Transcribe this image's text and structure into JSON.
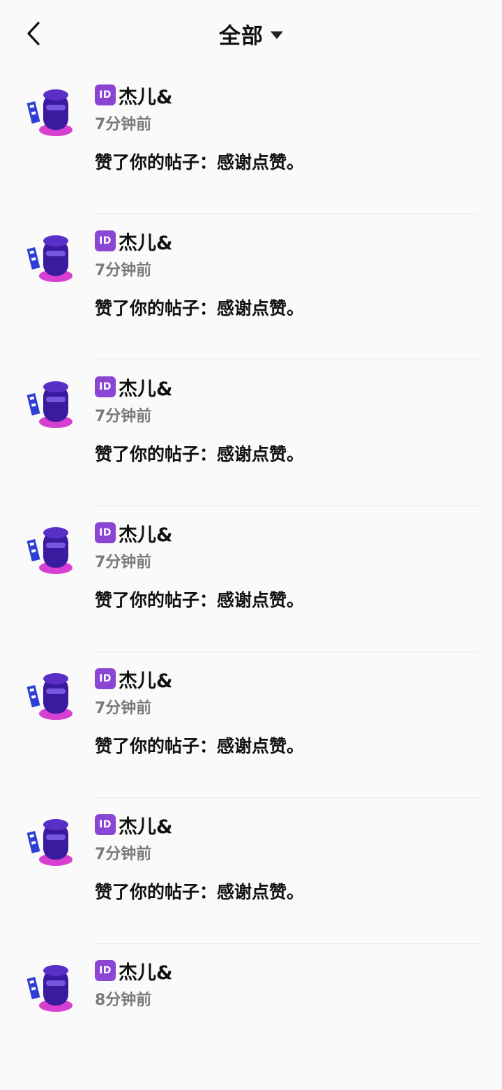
{
  "header": {
    "title": "全部",
    "back_icon": "chevron-left-icon",
    "dropdown_icon": "caret-down-icon"
  },
  "colors": {
    "background": "#fafafa",
    "text_primary": "#111111",
    "text_secondary": "#7a7a7a",
    "id_badge": "#8b45d3",
    "divider": "#e6e6e6"
  },
  "notifications": [
    {
      "badge": "ID",
      "name": "杰儿&",
      "time": "7分钟前",
      "message": "赞了你的帖子：感谢点赞。"
    },
    {
      "badge": "ID",
      "name": "杰儿&",
      "time": "7分钟前",
      "message": "赞了你的帖子：感谢点赞。"
    },
    {
      "badge": "ID",
      "name": "杰儿&",
      "time": "7分钟前",
      "message": "赞了你的帖子：感谢点赞。"
    },
    {
      "badge": "ID",
      "name": "杰儿&",
      "time": "7分钟前",
      "message": "赞了你的帖子：感谢点赞。"
    },
    {
      "badge": "ID",
      "name": "杰儿&",
      "time": "7分钟前",
      "message": "赞了你的帖子：感谢点赞。"
    },
    {
      "badge": "ID",
      "name": "杰儿&",
      "time": "7分钟前",
      "message": "赞了你的帖子：感谢点赞。"
    },
    {
      "badge": "ID",
      "name": "杰儿&",
      "time": "8分钟前",
      "message": ""
    }
  ]
}
